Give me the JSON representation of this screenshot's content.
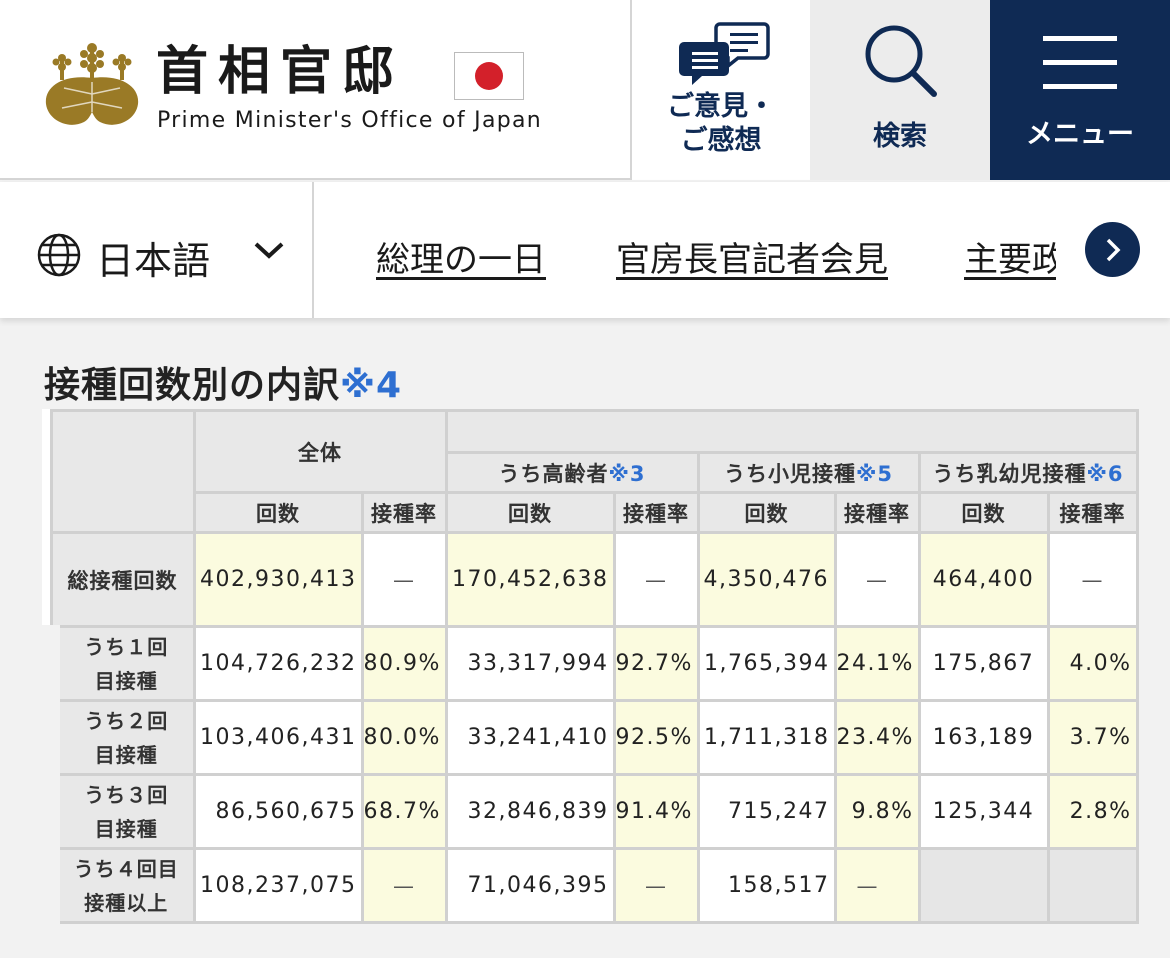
{
  "header": {
    "title_ja": "首相官邸",
    "title_en": "Prime Minister's Office of Japan",
    "feedback_label_1": "ご意見・",
    "feedback_label_2": "ご感想",
    "search_label": "検索",
    "menu_label": "メニュー",
    "colors": {
      "navy": "#0f2a54",
      "crest_gold": "#9a7a26",
      "flag_red": "#d3202a"
    }
  },
  "nav": {
    "language": "日本語",
    "links": [
      "総理の一日",
      "官房長官記者会見",
      "主要政"
    ]
  },
  "section": {
    "title": "接種回数別の内訳",
    "title_note": "※4"
  },
  "table": {
    "group_all": "全体",
    "group_elderly": "うち高齢者",
    "group_elderly_note": "※3",
    "group_child": "うち小児接種",
    "group_child_note": "※5",
    "group_infant": "うち乳幼児接種",
    "group_infant_note": "※6",
    "col_count": "回数",
    "col_rate": "接種率",
    "rows": [
      {
        "label": "総接種回数",
        "cells": [
          "402,930,413",
          "—",
          "170,452,638",
          "—",
          "4,350,476",
          "—",
          "464,400",
          "—"
        ]
      },
      {
        "label_1": "うち１回",
        "label_2": "目接種",
        "cells": [
          "104,726,232",
          "80.9%",
          "33,317,994",
          "92.7%",
          "1,765,394",
          "24.1%",
          "175,867",
          "4.0%"
        ]
      },
      {
        "label_1": "うち２回",
        "label_2": "目接種",
        "cells": [
          "103,406,431",
          "80.0%",
          "33,241,410",
          "92.5%",
          "1,711,318",
          "23.4%",
          "163,189",
          "3.7%"
        ]
      },
      {
        "label_1": "うち３回",
        "label_2": "目接種",
        "cells": [
          "86,560,675",
          "68.7%",
          "32,846,839",
          "91.4%",
          "715,247",
          "9.8%",
          "125,344",
          "2.8%"
        ]
      },
      {
        "label_1": "うち４回目",
        "label_2": "接種以上",
        "cells": [
          "108,237,075",
          "—",
          "71,046,395",
          "—",
          "158,517",
          "—",
          "",
          ""
        ]
      }
    ]
  }
}
